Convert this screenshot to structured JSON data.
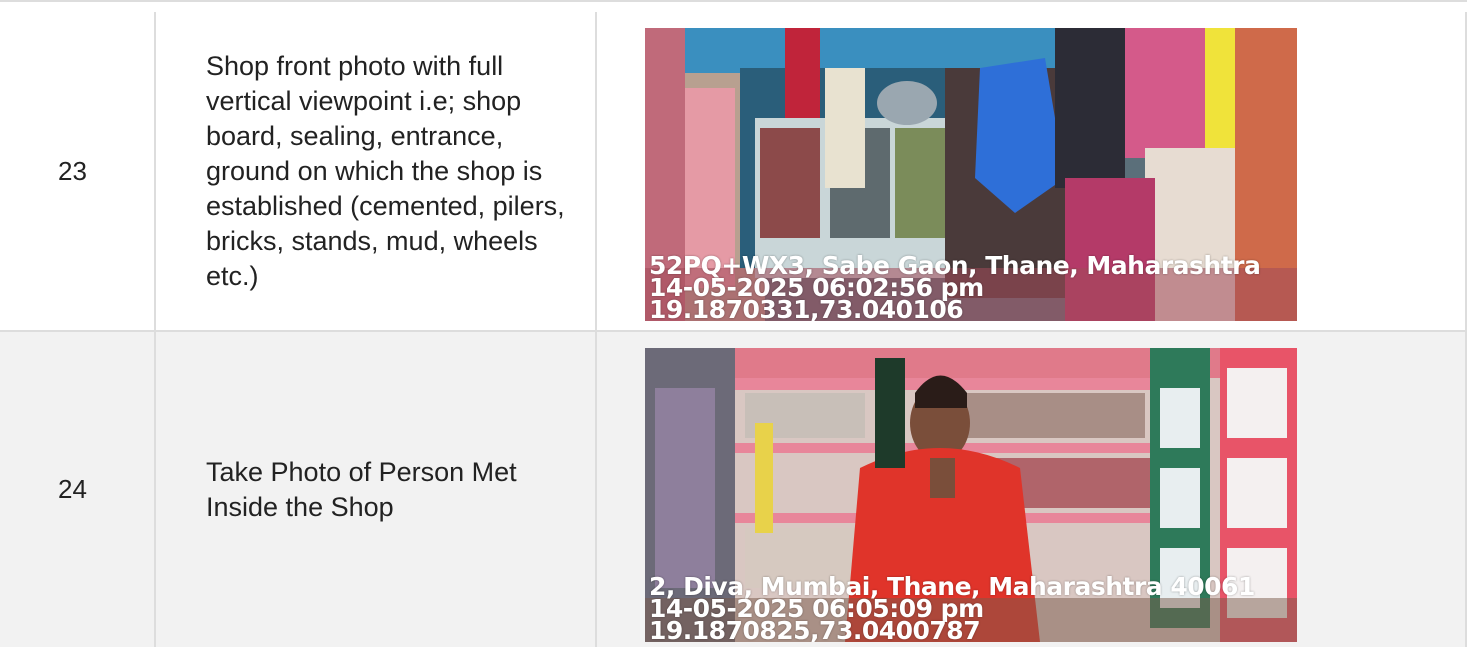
{
  "rows": [
    {
      "number": "23",
      "description": "Shop front photo with full vertical viewpoint i.e; shop board, sealing, entrance, ground on which the shop is established (cemented, pilers, bricks, stands, mud, wheels etc.)",
      "photo_stamp": {
        "line1": "52PQ+WX3, Sabe Gaon, Thane, Maharashtra",
        "line2": "14-05-2025 06:02:56 pm",
        "line3": "19.1870331,73.040106"
      }
    },
    {
      "number": "24",
      "description": "Take Photo of Person Met Inside the Shop",
      "photo_stamp": {
        "line1": "2, Diva, Mumbai, Thane, Maharashtra 40061",
        "line2": "14-05-2025 06:05:09 pm",
        "line3": "19.1870825,73.0400787"
      }
    }
  ],
  "colors": {
    "border": "#dddddd",
    "row_alt_bg": "#f2f2f2",
    "text": "#222222",
    "stamp_text": "#ffffff"
  }
}
